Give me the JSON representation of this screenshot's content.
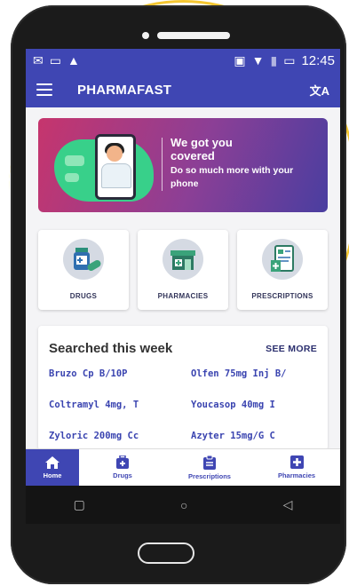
{
  "statusbar": {
    "time": "12:45",
    "left_icons": [
      "mail-icon",
      "cast-icon",
      "warning-icon"
    ],
    "right_icons": [
      "nfc-icon",
      "wifi-icon",
      "signal-icon",
      "battery-icon"
    ]
  },
  "app": {
    "title": "PHARMAFAST",
    "translate_glyph": "文A"
  },
  "banner": {
    "title": "We got you covered",
    "subtitle": "Do so much more with your phone"
  },
  "categories": [
    {
      "label": "DRUGS",
      "icon": "medicine-bottle-icon"
    },
    {
      "label": "PHARMACIES",
      "icon": "pharmacy-store-icon"
    },
    {
      "label": "PRESCRIPTIONS",
      "icon": "prescription-icon"
    }
  ],
  "searched": {
    "title": "Searched this week",
    "see_more": "SEE MORE",
    "items": [
      "Bruzo Cp B/10P",
      "Olfen 75mg Inj B/",
      "Coltramyl 4mg, T",
      "Youcasop 40mg I",
      "Zyloric 200mg Cc",
      "Azyter 15mg/G C"
    ]
  },
  "bottom_nav": [
    {
      "label": "Home",
      "icon": "home-icon",
      "active": true
    },
    {
      "label": "Drugs",
      "icon": "medical-bag-icon",
      "active": false
    },
    {
      "label": "Prescriptions",
      "icon": "clipboard-icon",
      "active": false
    },
    {
      "label": "Pharmacies",
      "icon": "plus-cross-icon",
      "active": false
    }
  ],
  "system_nav": {
    "recent": "▢",
    "home": "○",
    "back": "◁"
  },
  "colors": {
    "primary": "#3f46b3",
    "accent_green": "#38d08a",
    "banner_start": "#c6356d",
    "banner_end": "#4a3ea0"
  }
}
